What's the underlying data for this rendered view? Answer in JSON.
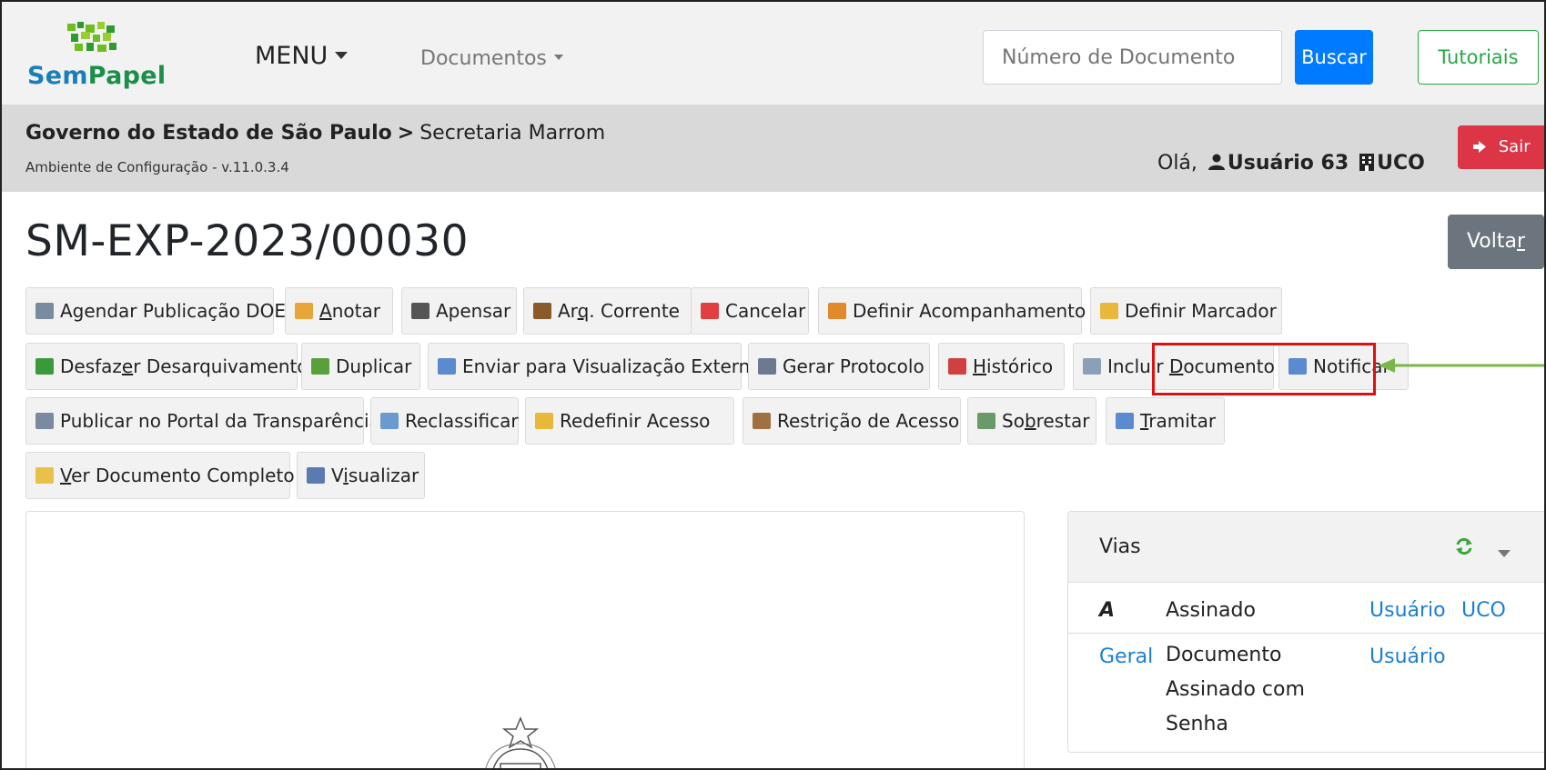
{
  "header": {
    "logo_text_a": "Sem",
    "logo_text_b": "Papel",
    "menu_label": "MENU",
    "documents_label": "Documentos",
    "search_placeholder": "Número de Documento",
    "search_button": "Buscar",
    "tutorials_button": "Tutoriais"
  },
  "breadcrumb": {
    "org": "Governo do Estado de São Paulo",
    "separator": ">",
    "unit": "Secretaria Marrom",
    "environment": "Ambiente de Configuração - v.11.0.3.4",
    "greeting": "Olá,",
    "user": "Usuário 63",
    "unit_code": "UCO",
    "logout": "Sair"
  },
  "page": {
    "title": "SM-EXP-2023/00030",
    "back_button": "Voltar"
  },
  "actions": {
    "row1": [
      {
        "label": "Agendar Publicação DOE",
        "icon": "document-schedule-icon",
        "color": "#7a8aa0"
      },
      {
        "label": "Anotar",
        "icon": "note-add-icon",
        "color": "#e7a53a"
      },
      {
        "label": "Apensar",
        "icon": "attach-icon",
        "color": "#555555"
      },
      {
        "label": "Arq. Corrente",
        "icon": "archive-icon",
        "color": "#8a5a2a"
      },
      {
        "label": "Cancelar",
        "icon": "cancel-icon",
        "color": "#e04040"
      },
      {
        "label": "Definir Acompanhamento",
        "icon": "user-folder-icon",
        "color": "#e08a2a"
      },
      {
        "label": "Definir Marcador",
        "icon": "folder-star-icon",
        "color": "#e8b83a"
      }
    ],
    "row2": [
      {
        "label": "Desfazer Desarquivamento",
        "icon": "undo-icon",
        "color": "#3a9a3a"
      },
      {
        "label": "Duplicar",
        "icon": "duplicate-icon",
        "color": "#5aa03a"
      },
      {
        "label": "Enviar para Visualização Externa",
        "icon": "send-mail-icon",
        "color": "#5a8ad0"
      },
      {
        "label": "Gerar Protocolo",
        "icon": "printer-icon",
        "color": "#6a7a90"
      },
      {
        "label": "Histórico",
        "icon": "calendar-icon",
        "color": "#d04040"
      },
      {
        "label": "Incluir Documento",
        "icon": "page-add-icon",
        "color": "#8aa0b8"
      },
      {
        "label": "Notificar",
        "icon": "notify-icon",
        "color": "#5a8ad0"
      }
    ],
    "row3": [
      {
        "label": "Publicar no Portal da Transparência",
        "icon": "publish-icon",
        "color": "#7a8aa0"
      },
      {
        "label": "Reclassificar",
        "icon": "edit-document-icon",
        "color": "#6a9ad0"
      },
      {
        "label": "Redefinir Acesso",
        "icon": "shield-icon",
        "color": "#e8b83a"
      },
      {
        "label": "Restrição de Acesso",
        "icon": "users-lock-icon",
        "color": "#a07040"
      },
      {
        "label": "Sobrestar",
        "icon": "hourglass-icon",
        "color": "#6a9a6a"
      },
      {
        "label": "Tramitar",
        "icon": "forward-mail-icon",
        "color": "#5a8ad0"
      }
    ],
    "row4": [
      {
        "label": "Ver Documento Completo",
        "icon": "folder-open-icon",
        "color": "#e8c04a"
      },
      {
        "label": "Visualizar",
        "icon": "eye-icon",
        "color": "#5a7ab0"
      }
    ]
  },
  "vias": {
    "title": "Vias",
    "rows": [
      {
        "via": "A",
        "status": "Assinado",
        "user": "Usuário",
        "unit": "UCO"
      },
      {
        "via": "Geral",
        "status_lines": [
          "Documento",
          "Assinado com",
          "Senha"
        ],
        "user": "Usuário",
        "unit": ""
      }
    ]
  },
  "colors": {
    "primary": "#007bff",
    "success": "#28a745",
    "danger": "#dc3545",
    "secondary": "#6c757d",
    "highlight": "#e01010",
    "arrow": "#7ab648"
  }
}
